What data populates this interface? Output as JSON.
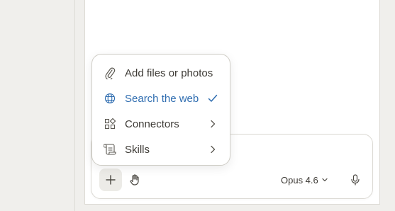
{
  "menu": {
    "items": [
      {
        "label": "Add files or photos",
        "icon": "paperclip-icon"
      },
      {
        "label": "Search the web",
        "icon": "globe-icon",
        "selected": true
      },
      {
        "label": "Connectors",
        "icon": "connectors-icon",
        "submenu": true
      },
      {
        "label": "Skills",
        "icon": "scroll-icon",
        "submenu": true
      }
    ]
  },
  "composer": {
    "model_label": "Opus 4.6",
    "plus_icon": "plus-icon",
    "hand_icon": "hand-icon",
    "mic_icon": "microphone-icon"
  },
  "colors": {
    "accent": "#2f6db0",
    "text": "#3d3a35",
    "background": "#f0efec"
  }
}
